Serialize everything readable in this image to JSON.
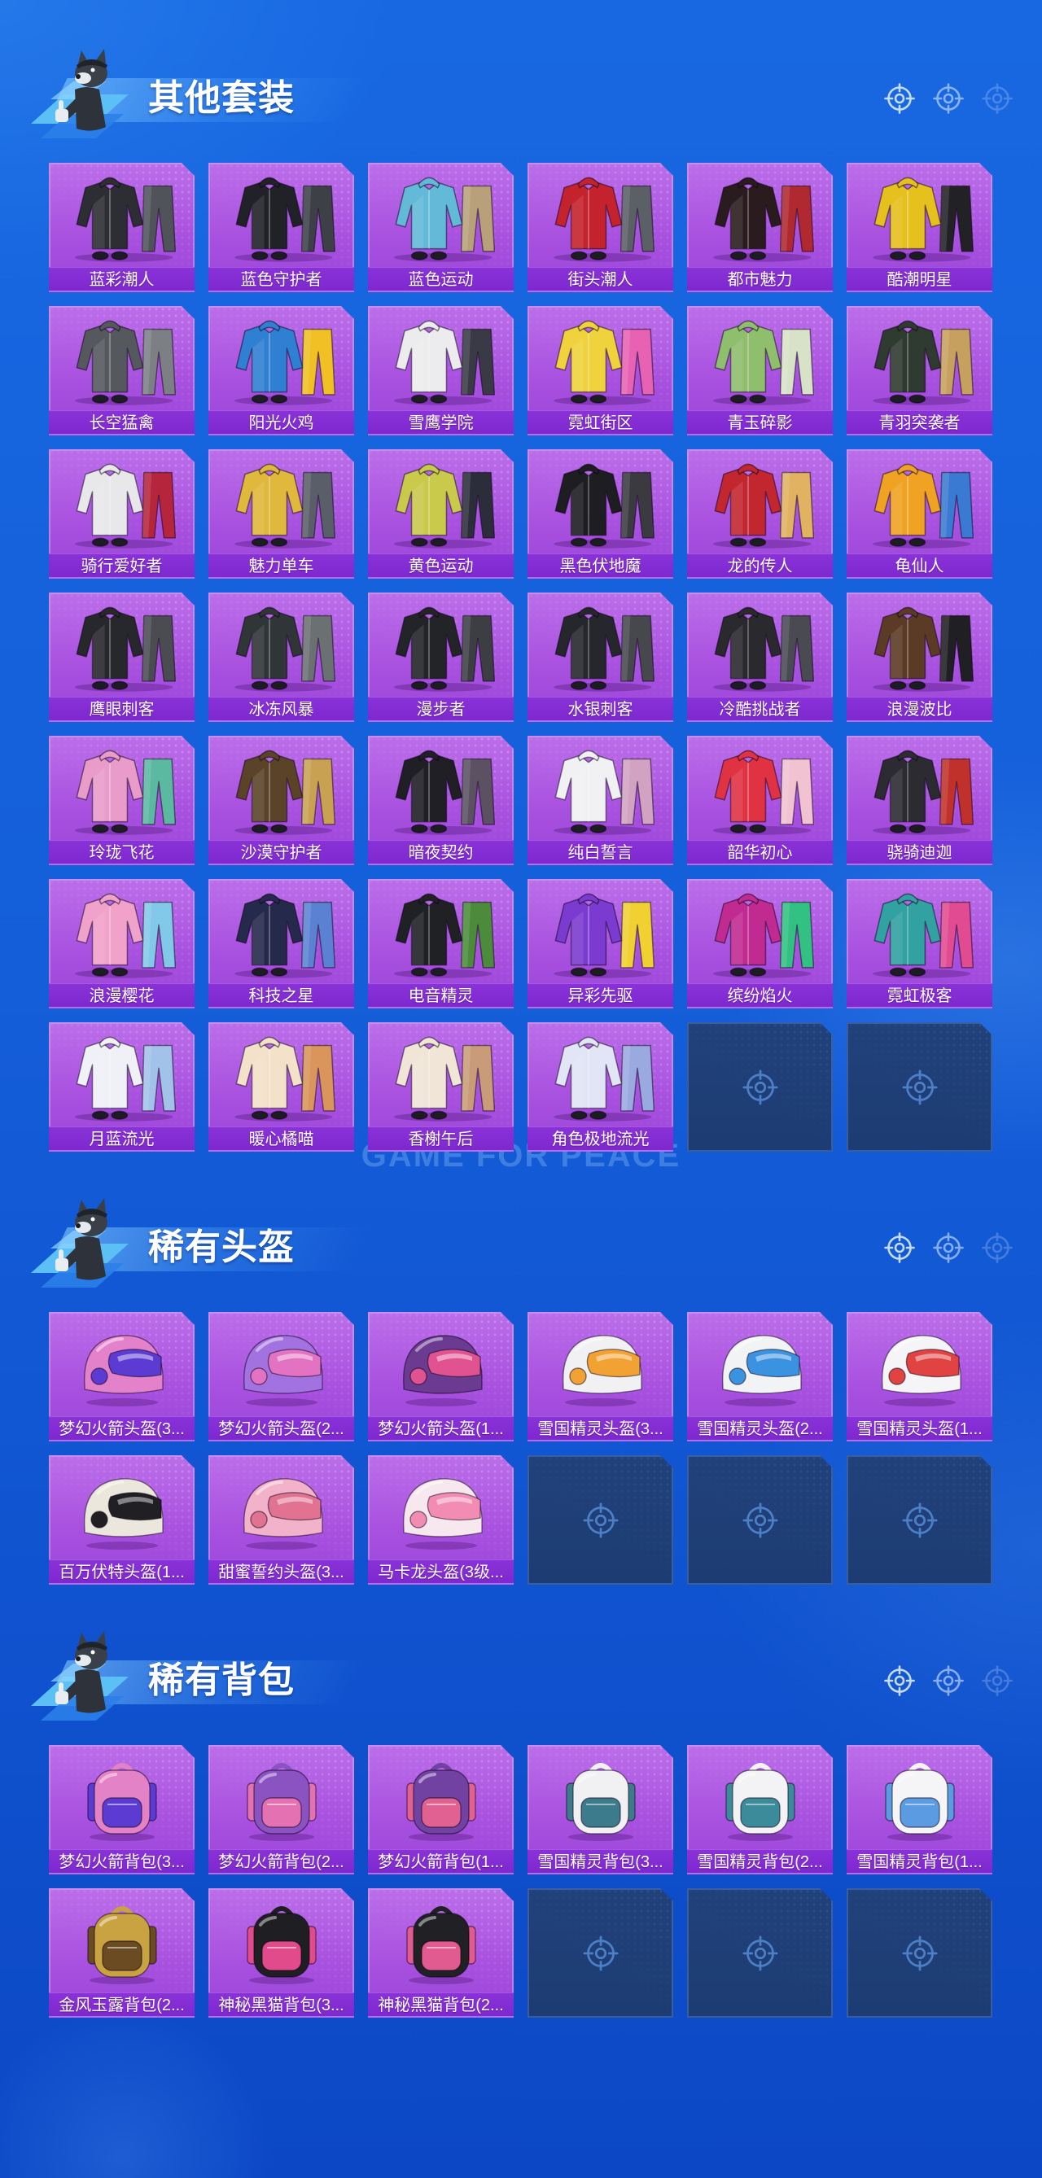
{
  "theme": {
    "background_top": "#1868e2",
    "background_bottom": "#0c48c6",
    "card_top": "#bb6ee9",
    "card_bottom": "#9a44d9",
    "label_bg": "#8a32d8",
    "empty_slot_bg": "#1d3c73",
    "text_color": "#ffffff"
  },
  "mascot_icon": "mascot-icon",
  "header_icon": "crosshair-icon",
  "empty_slot_icon": "crosshair-icon",
  "watermark": "GAME FOR PEACE",
  "sections": [
    {
      "title": "其他套装",
      "item_icon": "outfit-icon",
      "items": [
        {
          "name": "蓝彩潮人",
          "color": "#2d2e33",
          "accent": "#50535a"
        },
        {
          "name": "蓝色守护者",
          "color": "#202227",
          "accent": "#3d4047"
        },
        {
          "name": "蓝色运动",
          "color": "#62b9d8",
          "accent": "#b8a07a"
        },
        {
          "name": "街头潮人",
          "color": "#c4222c",
          "accent": "#5b5f66"
        },
        {
          "name": "都市魅力",
          "color": "#2a1c1e",
          "accent": "#b02830"
        },
        {
          "name": "酷潮明星",
          "color": "#e6c01c",
          "accent": "#222226"
        },
        {
          "name": "长空猛禽",
          "color": "#55595d",
          "accent": "#7c8084"
        },
        {
          "name": "阳光火鸡",
          "color": "#2f7fd2",
          "accent": "#f0c024"
        },
        {
          "name": "雪鹰学院",
          "color": "#ececee",
          "accent": "#3a3a46"
        },
        {
          "name": "霓虹街区",
          "color": "#f0d23c",
          "accent": "#e862b4"
        },
        {
          "name": "青玉碎影",
          "color": "#8fbe6c",
          "accent": "#d8e2c8"
        },
        {
          "name": "青羽突袭者",
          "color": "#2f3a30",
          "accent": "#c6a05e"
        },
        {
          "name": "骑行爱好者",
          "color": "#e8e8ea",
          "accent": "#b5253c"
        },
        {
          "name": "魅力单车",
          "color": "#dfb83c",
          "accent": "#5a5e68"
        },
        {
          "name": "黄色运动",
          "color": "#c9c94c",
          "accent": "#2c2d3a"
        },
        {
          "name": "黑色伏地魔",
          "color": "#1d1d22",
          "accent": "#3a3a40"
        },
        {
          "name": "龙的传人",
          "color": "#c2262f",
          "accent": "#e1b262"
        },
        {
          "name": "龟仙人",
          "color": "#f0a222",
          "accent": "#3a7ad2"
        },
        {
          "name": "鹰眼刺客",
          "color": "#27282c",
          "accent": "#4b4c52"
        },
        {
          "name": "冰冻风暴",
          "color": "#303538",
          "accent": "#6b7073"
        },
        {
          "name": "漫步者",
          "color": "#232428",
          "accent": "#3d3e44"
        },
        {
          "name": "水银刺客",
          "color": "#26272c",
          "accent": "#46484e"
        },
        {
          "name": "冷酷挑战者",
          "color": "#29292e",
          "accent": "#494a52"
        },
        {
          "name": "浪漫波比",
          "color": "#5b3b25",
          "accent": "#1f1f24"
        },
        {
          "name": "玲珑飞花",
          "color": "#e99cca",
          "accent": "#5bb9a2"
        },
        {
          "name": "沙漠守护者",
          "color": "#5b4329",
          "accent": "#c9a152"
        },
        {
          "name": "暗夜契约",
          "color": "#1f1f25",
          "accent": "#5b5162"
        },
        {
          "name": "纯白誓言",
          "color": "#f1f1f3",
          "accent": "#d2a2c2"
        },
        {
          "name": "韶华初心",
          "color": "#e03242",
          "accent": "#f1c2d2"
        },
        {
          "name": "骁骑迪迦",
          "color": "#2b2b31",
          "accent": "#c1312b"
        },
        {
          "name": "浪漫樱花",
          "color": "#f1a2ca",
          "accent": "#82c9e9"
        },
        {
          "name": "科技之星",
          "color": "#25294b",
          "accent": "#5b82d2"
        },
        {
          "name": "电音精灵",
          "color": "#1f2125",
          "accent": "#4b8b3b"
        },
        {
          "name": "异彩先驱",
          "color": "#7b3bd1",
          "accent": "#f1d132"
        },
        {
          "name": "缤纷焰火",
          "color": "#c12b91",
          "accent": "#32c182"
        },
        {
          "name": "霓虹极客",
          "color": "#32a1a1",
          "accent": "#e14b91"
        },
        {
          "name": "月蓝流光",
          "color": "#eff1f7",
          "accent": "#a2c2e9"
        },
        {
          "name": "暖心橘喵",
          "color": "#f3e1c9",
          "accent": "#d9955b"
        },
        {
          "name": "香榭午后",
          "color": "#f1e5d7",
          "accent": "#c99b79"
        },
        {
          "name": "角色极地流光",
          "color": "#e1e5f5",
          "accent": "#9ba9e1"
        },
        {
          "empty": true
        },
        {
          "empty": true
        }
      ]
    },
    {
      "title": "稀有头盔",
      "item_icon": "helmet-icon",
      "items": [
        {
          "name": "梦幻火箭头盔(3...",
          "color": "#e382cb",
          "accent": "#5b3bd1"
        },
        {
          "name": "梦幻火箭头盔(2...",
          "color": "#a272e1",
          "accent": "#e472c2"
        },
        {
          "name": "梦幻火箭头盔(1...",
          "color": "#6b3b91",
          "accent": "#e15291"
        },
        {
          "name": "雪国精灵头盔(3...",
          "color": "#f1f1f3",
          "accent": "#f2a232"
        },
        {
          "name": "雪国精灵头盔(2...",
          "color": "#f2f3f5",
          "accent": "#3b92e1"
        },
        {
          "name": "雪国精灵头盔(1...",
          "color": "#f5f5f7",
          "accent": "#e14242"
        },
        {
          "name": "百万伏特头盔(1...",
          "color": "#ebe7dc",
          "accent": "#1f1f24"
        },
        {
          "name": "甜蜜誓约头盔(3...",
          "color": "#f2b2ca",
          "accent": "#e17292"
        },
        {
          "name": "马卡龙头盔(3级...",
          "color": "#f7e7ef",
          "accent": "#f28cb2"
        },
        {
          "empty": true
        },
        {
          "empty": true
        },
        {
          "empty": true
        }
      ]
    },
    {
      "title": "稀有背包",
      "item_icon": "backpack-icon",
      "items": [
        {
          "name": "梦幻火箭背包(3...",
          "color": "#e382c6",
          "accent": "#5b3bd1"
        },
        {
          "name": "梦幻火箭背包(2...",
          "color": "#8b52c2",
          "accent": "#e472b2"
        },
        {
          "name": "梦幻火箭背包(1...",
          "color": "#7142a1",
          "accent": "#e16292"
        },
        {
          "name": "雪国精灵背包(3...",
          "color": "#f1f1f3",
          "accent": "#3b7b8b"
        },
        {
          "name": "雪国精灵背包(2...",
          "color": "#f3f3f5",
          "accent": "#3b8b9b"
        },
        {
          "name": "雪国精灵背包(1...",
          "color": "#f5f5f7",
          "accent": "#5b9be1"
        },
        {
          "name": "金风玉露背包(2...",
          "color": "#c9a242",
          "accent": "#6b4b22"
        },
        {
          "name": "神秘黑猫背包(3...",
          "color": "#1f1f23",
          "accent": "#e14b8b"
        },
        {
          "name": "神秘黑猫背包(2...",
          "color": "#212125",
          "accent": "#e15b91"
        },
        {
          "empty": true
        },
        {
          "empty": true
        },
        {
          "empty": true
        }
      ]
    }
  ]
}
